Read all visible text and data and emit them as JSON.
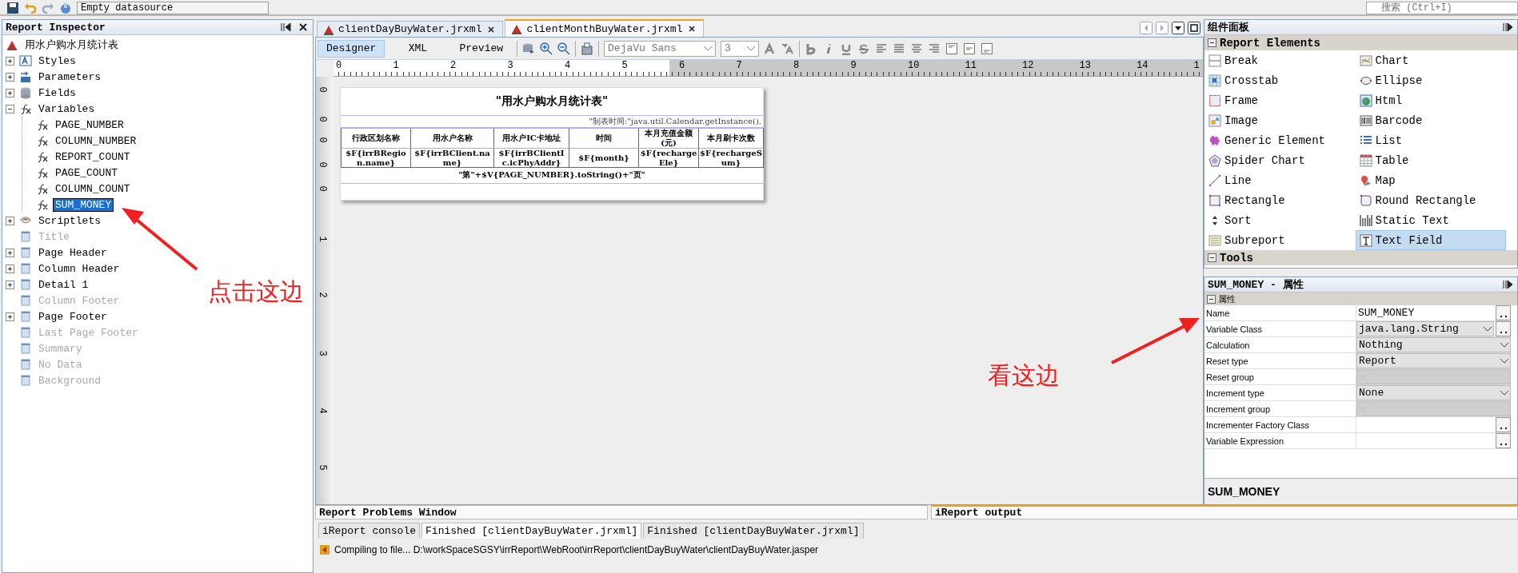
{
  "toolbar": {
    "datasource": "Empty datasource",
    "search_placeholder": "搜索 (Ctrl+I)"
  },
  "inspector": {
    "title": "Report Inspector",
    "tree": [
      {
        "label": "用水户购水月统计表",
        "kind": "report",
        "selected": false,
        "disabled": false,
        "children": [
          {
            "label": "Styles",
            "kind": "styles",
            "expanded": false,
            "selected": false,
            "disabled": false
          },
          {
            "label": "Parameters",
            "kind": "parameters",
            "expanded": false,
            "selected": false,
            "disabled": false
          },
          {
            "label": "Fields",
            "kind": "fields",
            "expanded": false,
            "selected": false,
            "disabled": false
          },
          {
            "label": "Variables",
            "kind": "variable",
            "expanded": true,
            "selected": false,
            "disabled": false,
            "children": [
              {
                "label": "PAGE_NUMBER",
                "kind": "variable",
                "selected": false,
                "disabled": false
              },
              {
                "label": "COLUMN_NUMBER",
                "kind": "variable",
                "selected": false,
                "disabled": false
              },
              {
                "label": "REPORT_COUNT",
                "kind": "variable",
                "selected": false,
                "disabled": false
              },
              {
                "label": "PAGE_COUNT",
                "kind": "variable",
                "selected": false,
                "disabled": false
              },
              {
                "label": "COLUMN_COUNT",
                "kind": "variable",
                "selected": false,
                "disabled": false
              },
              {
                "label": "SUM_MONEY",
                "kind": "variable",
                "selected": true,
                "disabled": false
              }
            ]
          },
          {
            "label": "Scriptlets",
            "kind": "scriptlets",
            "expanded": false,
            "selected": false,
            "disabled": false
          },
          {
            "label": "Title",
            "kind": "band",
            "selected": false,
            "disabled": true
          },
          {
            "label": "Page Header",
            "kind": "band",
            "expanded": false,
            "selected": false,
            "disabled": false
          },
          {
            "label": "Column Header",
            "kind": "band",
            "expanded": false,
            "selected": false,
            "disabled": false
          },
          {
            "label": "Detail 1",
            "kind": "band",
            "expanded": false,
            "selected": false,
            "disabled": false
          },
          {
            "label": "Column Footer",
            "kind": "band",
            "selected": false,
            "disabled": true
          },
          {
            "label": "Page Footer",
            "kind": "band",
            "expanded": false,
            "selected": false,
            "disabled": false
          },
          {
            "label": "Last Page Footer",
            "kind": "band",
            "selected": false,
            "disabled": true
          },
          {
            "label": "Summary",
            "kind": "band",
            "selected": false,
            "disabled": true
          },
          {
            "label": "No Data",
            "kind": "band",
            "selected": false,
            "disabled": true
          },
          {
            "label": "Background",
            "kind": "band",
            "selected": false,
            "disabled": true
          }
        ]
      }
    ]
  },
  "editor": {
    "tabs": [
      {
        "label": "clientDayBuyWater.jrxml",
        "selected": false
      },
      {
        "label": "clientMonthBuyWater.jrxml",
        "selected": true
      }
    ],
    "views": [
      {
        "label": "Designer",
        "selected": true
      },
      {
        "label": "XML",
        "selected": false
      },
      {
        "label": "Preview",
        "selected": false
      }
    ],
    "font": "DejaVu Sans",
    "font_size": "3",
    "ruler_h": [
      "0",
      "1",
      "2",
      "3",
      "4",
      "5",
      "6",
      "7",
      "8",
      "9",
      "10",
      "11",
      "12",
      "13",
      "14",
      "1"
    ],
    "ruler_v": [
      "0",
      "0",
      "0",
      "0",
      "0",
      "1",
      "2",
      "3",
      "4",
      "5"
    ],
    "report": {
      "title": "\"用水户购水月统计表\"",
      "page_header": "\"制表时间:\"java.util.Calendar.getInstance().",
      "columns": [
        "行政区划名称",
        "用水户名称",
        "用水户IC卡地址",
        "时间",
        "本月充值金额(元)",
        "本月刷卡次数"
      ],
      "fields": [
        "$F{irrBRegion.name}",
        "$F{irrBClient.name}",
        "$F{irrBClientIc.icPhyAddr}",
        "$F{month}",
        "$F{rechargeEle}",
        "$F{rechargeSum}"
      ],
      "footer": "\"第\"+$V{PAGE_NUMBER}.toString()+\"页\""
    }
  },
  "palette": {
    "title": "组件面板",
    "sections": [
      {
        "label": "Report Elements",
        "expanded": true,
        "items": [
          {
            "label": "Break",
            "kind": "break",
            "selected": false
          },
          {
            "label": "Chart",
            "kind": "chart",
            "selected": false
          },
          {
            "label": "Crosstab",
            "kind": "crosstab",
            "selected": false
          },
          {
            "label": "Ellipse",
            "kind": "ellipse",
            "selected": false
          },
          {
            "label": "Frame",
            "kind": "frame",
            "selected": false
          },
          {
            "label": "Html",
            "kind": "html",
            "selected": false
          },
          {
            "label": "Image",
            "kind": "image",
            "selected": false
          },
          {
            "label": "Barcode",
            "kind": "barcode",
            "selected": false
          },
          {
            "label": "Generic Element",
            "kind": "generic",
            "selected": false
          },
          {
            "label": "List",
            "kind": "list",
            "selected": false
          },
          {
            "label": "Spider Chart",
            "kind": "spider",
            "selected": false
          },
          {
            "label": "Table",
            "kind": "table",
            "selected": false
          },
          {
            "label": "Line",
            "kind": "line",
            "selected": false
          },
          {
            "label": "Map",
            "kind": "map",
            "selected": false
          },
          {
            "label": "Rectangle",
            "kind": "rectangle",
            "selected": false
          },
          {
            "label": "Round Rectangle",
            "kind": "roundrect",
            "selected": false
          },
          {
            "label": "Sort",
            "kind": "sort",
            "selected": false
          },
          {
            "label": "Static Text",
            "kind": "statictext",
            "selected": false
          },
          {
            "label": "Subreport",
            "kind": "subreport",
            "selected": false
          },
          {
            "label": "Text Field",
            "kind": "textfield",
            "selected": true
          }
        ]
      },
      {
        "label": "Tools",
        "expanded": true
      }
    ]
  },
  "properties": {
    "title": "SUM_MONEY - 属性",
    "group": "属性",
    "rows": [
      {
        "name": "Name",
        "value": "SUM_MONEY",
        "kind": "text",
        "button": true,
        "disabled": false
      },
      {
        "name": "Variable Class",
        "value": "java.lang.String",
        "kind": "combo",
        "button": true,
        "disabled": false
      },
      {
        "name": "Calculation",
        "value": "Nothing",
        "kind": "combo",
        "button": false,
        "disabled": false
      },
      {
        "name": "Reset type",
        "value": "Report",
        "kind": "combo",
        "button": false,
        "disabled": false
      },
      {
        "name": "Reset group",
        "kind": "combo",
        "button": false,
        "disabled": true
      },
      {
        "name": "Increment type",
        "value": "None",
        "kind": "combo",
        "button": false,
        "disabled": false
      },
      {
        "name": "Increment group",
        "kind": "combo",
        "button": false,
        "disabled": true
      },
      {
        "name": "Incrementer Factory Class",
        "kind": "text",
        "button": true,
        "disabled": false
      },
      {
        "name": "Variable Expression",
        "kind": "text",
        "button": true,
        "disabled": false
      }
    ],
    "description": "SUM_MONEY"
  },
  "bottom": {
    "problems_title": "Report Problems Window",
    "output_title": "iReport output",
    "tabs": [
      {
        "label": "iReport console",
        "selected": false
      },
      {
        "label": "Finished [clientDayBuyWater.jrxml]",
        "selected": true
      },
      {
        "label": "Finished [clientDayBuyWater.jrxml]",
        "selected": false
      }
    ],
    "log": "Compiling to file... D:\\workSpaceSGSY\\irrReport\\WebRoot\\irrReport\\clientDayBuyWater\\clientDayBuyWater.jasper"
  },
  "annotations": [
    {
      "text": "点击这边"
    },
    {
      "text": "看这边"
    }
  ]
}
